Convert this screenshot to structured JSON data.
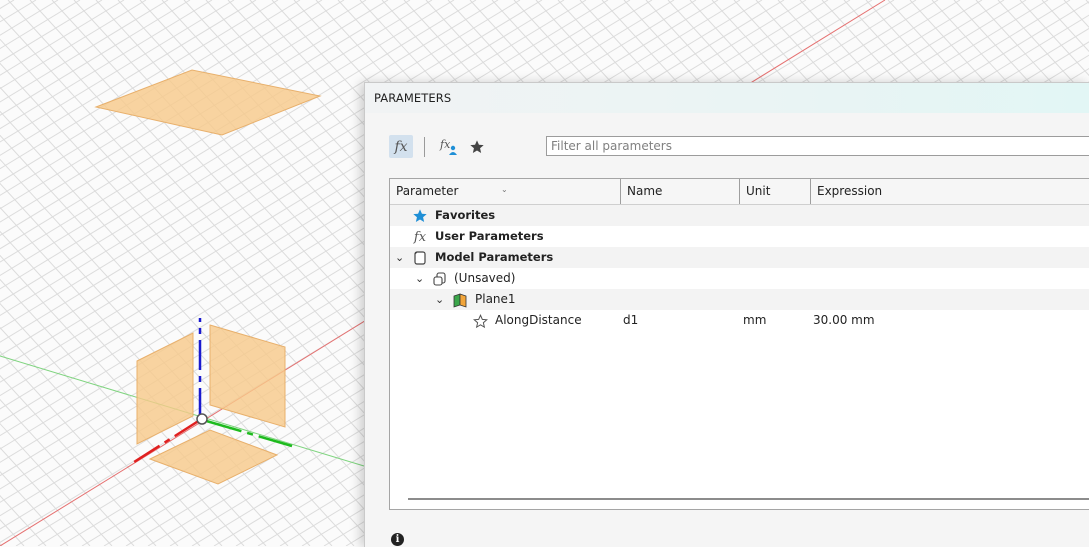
{
  "dialog": {
    "title": "PARAMETERS",
    "filter_placeholder": "Filter all parameters",
    "toolbar": {
      "all_icon": "fx-icon",
      "user_icon": "fx-user-icon",
      "favorites_icon": "star-icon"
    }
  },
  "table": {
    "columns": [
      "Parameter",
      "Name",
      "Unit",
      "Expression"
    ],
    "rows": {
      "favorites": {
        "label": "Favorites",
        "icon": "star-icon"
      },
      "user_params": {
        "label": "User Parameters",
        "icon": "fx-icon"
      },
      "model_params": {
        "label": "Model Parameters",
        "icon": "component-icon"
      },
      "unsaved": {
        "label": "(Unsaved)",
        "icon": "document-icon"
      },
      "plane1": {
        "label": "Plane1",
        "icon": "plane-icon"
      },
      "along": {
        "label": "AlongDistance",
        "name": "d1",
        "unit": "mm",
        "expression": "30.00 mm",
        "icon": "star-outline-icon"
      }
    }
  },
  "colors": {
    "favorite_star": "#1f8fd6",
    "plane_fill": "#f7c98a",
    "axis_x": "#e02020",
    "axis_y": "#1dbb1d",
    "axis_z": "#1a1acf"
  }
}
